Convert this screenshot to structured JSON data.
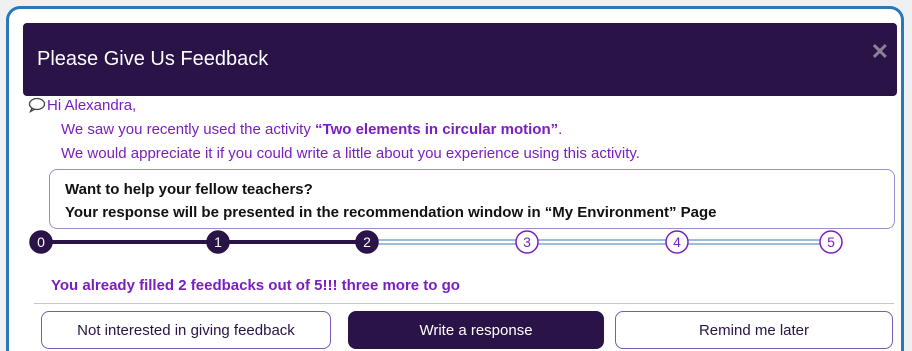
{
  "dialog": {
    "title": "Please Give Us Feedback",
    "close_icon": "close-icon"
  },
  "message": {
    "greeting": "Hi Alexandra,",
    "line1_prefix": "We saw you recently used the activity ",
    "activity_name": "“Two elements in circular motion”",
    "line1_suffix": ".",
    "line2": "We would appreciate it if you could write a little about you experience using this activity."
  },
  "info_box": {
    "line1": "Want to help your fellow teachers?",
    "line2": "Your response will be presented in the recommendation window in “My Environment” Page"
  },
  "progress": {
    "steps": [
      "0",
      "1",
      "2",
      "3",
      "4",
      "5"
    ],
    "completed": 2,
    "total": 5,
    "text": "You already filled 2 feedbacks out of 5!!!  three more to go"
  },
  "buttons": {
    "not_interested": "Not interested in giving feedback",
    "write": "Write a response",
    "remind": "Remind me later"
  },
  "colors": {
    "header_bg": "#2a1347",
    "accent_purple": "#7a1fbf",
    "border_blue": "#2b78b6",
    "pending_line": "#7fa7d3"
  }
}
